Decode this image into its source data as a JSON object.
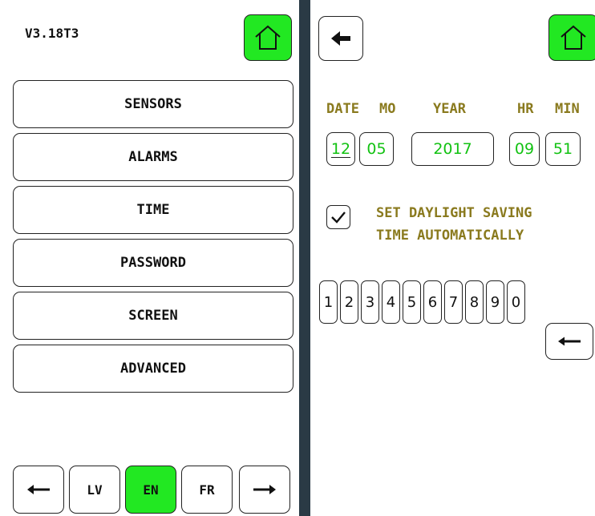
{
  "left_panel": {
    "version": "V3.18T3",
    "home_icon": "home-icon",
    "menu": [
      {
        "label": "SENSORS"
      },
      {
        "label": "ALARMS"
      },
      {
        "label": "TIME"
      },
      {
        "label": "PASSWORD"
      },
      {
        "label": "SCREEN"
      },
      {
        "label": "ADVANCED"
      }
    ],
    "language_bar": {
      "prev_icon": "arrow-left-icon",
      "languages": [
        "LV",
        "EN",
        "FR"
      ],
      "selected": "EN",
      "next_icon": "arrow-right-icon"
    }
  },
  "right_panel": {
    "back_icon": "arrow-left-icon",
    "home_icon": "home-icon",
    "labels": {
      "date": "DATE",
      "month": "MO",
      "year": "YEAR",
      "hour": "HR",
      "minute": "MIN"
    },
    "values": {
      "date": "12",
      "month": "05",
      "year": "2017",
      "hour": "09",
      "minute": "51"
    },
    "dst": {
      "checked": true,
      "line1": "SET DAYLIGHT SAVING",
      "line2": "TIME AUTOMATICALLY"
    },
    "keypad": [
      "1",
      "2",
      "3",
      "4",
      "5",
      "6",
      "7",
      "8",
      "9",
      "0"
    ],
    "backspace_icon": "backspace-arrow-icon"
  },
  "colors": {
    "accent_green": "#22e822",
    "value_green": "#12c212",
    "label_olive": "#8a7a1e",
    "background": "#2a3a45"
  }
}
